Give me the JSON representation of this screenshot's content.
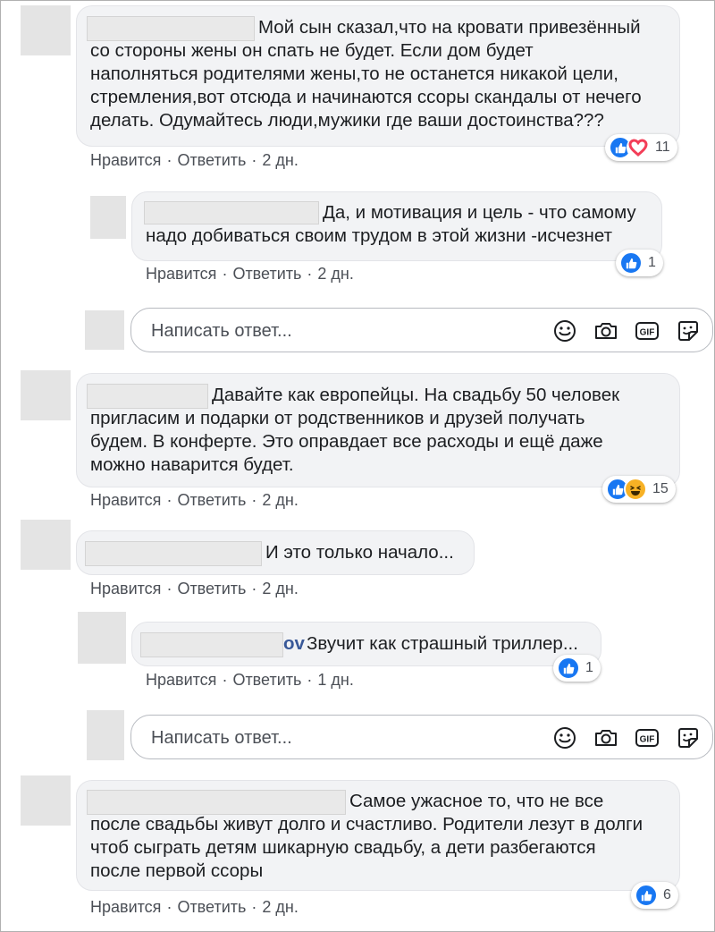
{
  "comments": [
    {
      "lines": [
        "Мой сын сказал,что на кровати привезённый",
        "со стороны жены он спать не будет. Если дом будет",
        "наполняться родителями жены,то не останется никакой цели,",
        "стремления,вот отсюда и начинаются ссоры скандалы от нечего",
        "делать. Одумайтесь люди,мужики где ваши достоинства???"
      ],
      "like": "Нравится",
      "reply": "Ответить",
      "time": "2 дн.",
      "reaction_count": "11",
      "reactions": [
        "like-icon",
        "love-icon"
      ]
    },
    {
      "lines": [
        "Да, и мотивация и цель - что самому",
        "надо добиваться своим трудом в этой жизни -исчезнет"
      ],
      "like": "Нравится",
      "reply": "Ответить",
      "time": "2 дн.",
      "reaction_count": "1",
      "reactions": [
        "like-icon"
      ]
    },
    {
      "lines": [
        "Давайте как европейцы. На свадьбу 50 человек",
        "пригласим и подарки от родственников и друзей получать",
        "будем. В конферте. Это оправдает все расходы и ещё даже",
        "можно наварится будет."
      ],
      "like": "Нравится",
      "reply": "Ответить",
      "time": "2 дн.",
      "reaction_count": "15",
      "reactions": [
        "like-icon",
        "haha-icon"
      ]
    },
    {
      "lines": [
        "И это только начало..."
      ],
      "like": "Нравится",
      "reply": "Ответить",
      "time": "2 дн."
    },
    {
      "name_fragment": "ov",
      "lines": [
        "Звучит как страшный триллер..."
      ],
      "like": "Нравится",
      "reply": "Ответить",
      "time": "1 дн.",
      "reaction_count": "1",
      "reactions": [
        "like-icon"
      ]
    },
    {
      "lines": [
        "Самое ужасное то, что не все",
        "после свадьбы живут долго и счастливо. Родители лезут в долги",
        "чтоб сыграть детям шикарную свадьбу, а дети разбегаются",
        "после первой ссоры"
      ],
      "like": "Нравится",
      "reply": "Ответить",
      "time": "2 дн.",
      "reaction_count": "6",
      "reactions": [
        "like-icon"
      ]
    }
  ],
  "reply_box": {
    "placeholder": "Написать ответ...",
    "tools": [
      "emoji-icon",
      "camera-icon",
      "gif-icon",
      "sticker-icon"
    ],
    "gif_label": "GIF"
  },
  "colors": {
    "like_blue": "#1877f2",
    "love_red": "#f33e58",
    "haha_yellow": "#f7b125",
    "bubble_bg": "#f2f3f5"
  }
}
